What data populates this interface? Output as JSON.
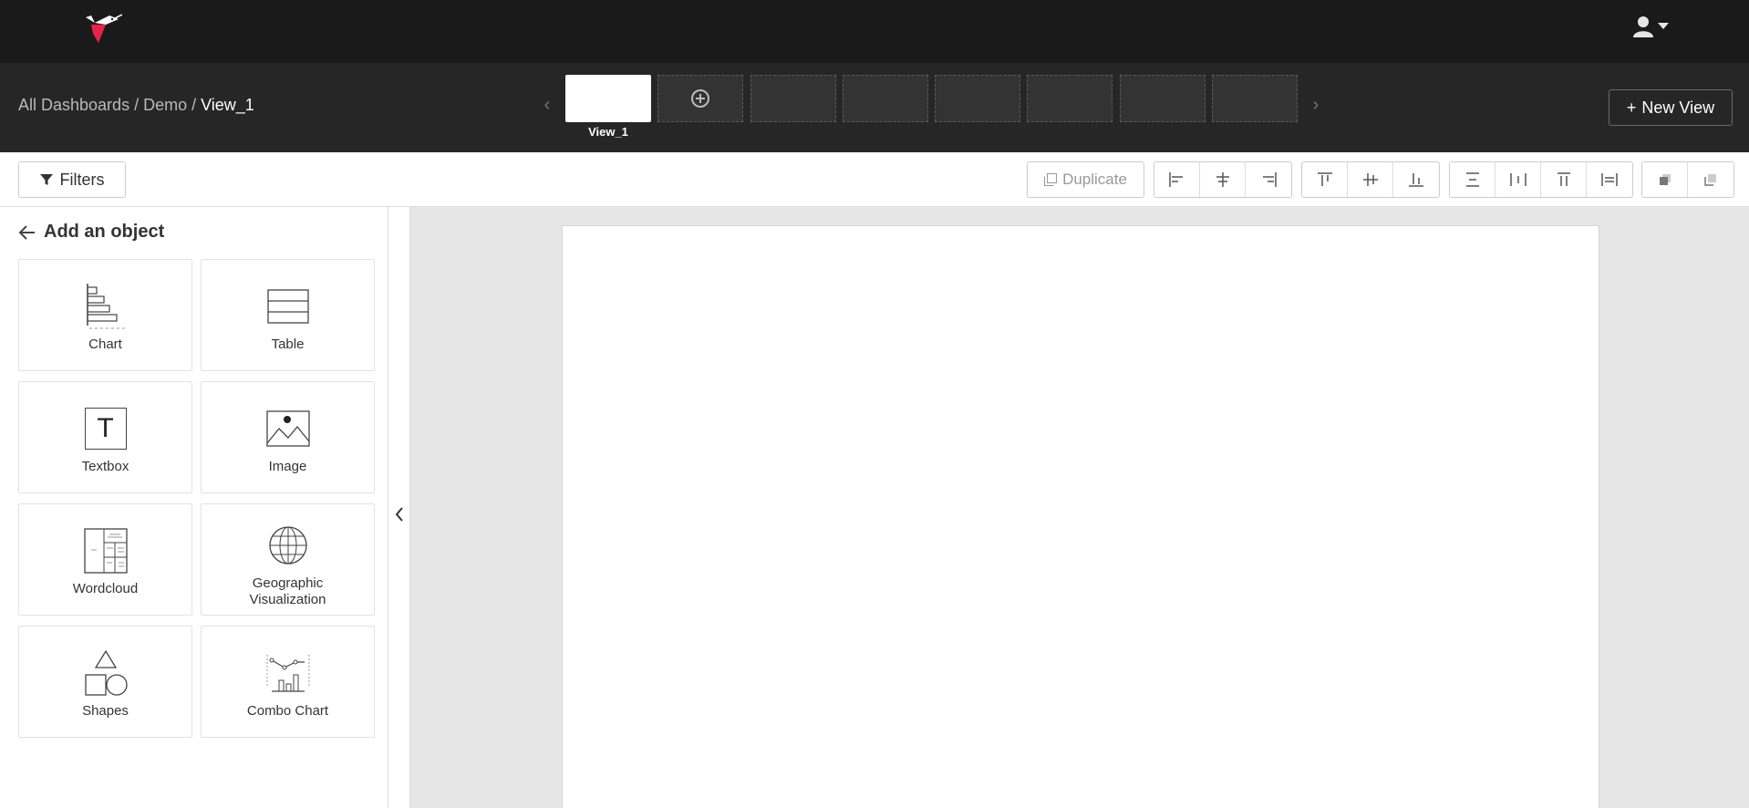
{
  "header": {
    "logo": "hummingbird-logo",
    "user_icon": "user-icon"
  },
  "breadcrumb": {
    "all_dashboards": "All Dashboards",
    "sep1": "/",
    "dashboard": "Demo",
    "sep2": "/",
    "view": "View_1"
  },
  "views": {
    "active_label": "View_1",
    "prev_arrow": "‹",
    "next_arrow": "›",
    "empty_slots": 6
  },
  "new_view_button": {
    "icon": "+",
    "label": "New View"
  },
  "toolbar": {
    "filters_label": "Filters",
    "duplicate_label": "Duplicate"
  },
  "panel": {
    "title": "Add an object",
    "tiles": [
      {
        "label": "Chart",
        "icon": "chart-icon"
      },
      {
        "label": "Table",
        "icon": "table-icon"
      },
      {
        "label": "Textbox",
        "icon": "textbox-icon"
      },
      {
        "label": "Image",
        "icon": "image-icon"
      },
      {
        "label": "Wordcloud",
        "icon": "wordcloud-icon"
      },
      {
        "label": "Geographic Visualization",
        "icon": "globe-icon"
      },
      {
        "label": "Shapes",
        "icon": "shapes-icon"
      },
      {
        "label": "Combo Chart",
        "icon": "combo-chart-icon"
      }
    ],
    "textbox_glyph": "T"
  },
  "colors": {
    "topbar": "#1a1a1a",
    "viewbar": "#262626",
    "accent_logo": "#e8234a",
    "canvas_bg": "#e6e6e6"
  }
}
